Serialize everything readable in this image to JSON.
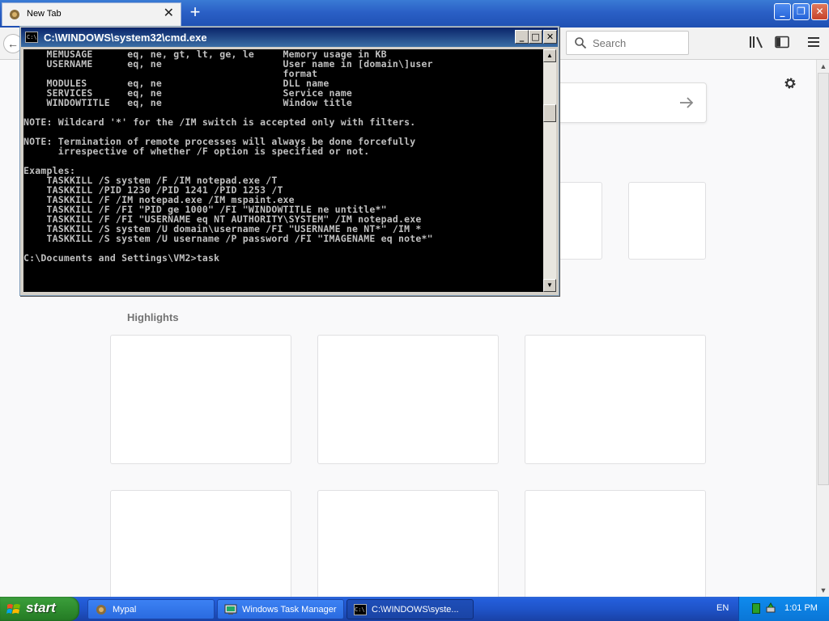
{
  "browser": {
    "tab_label": "New Tab",
    "tab_close": "✕",
    "new_tab": "+",
    "window_controls": {
      "minimize": "_",
      "maximize": "❐",
      "close": "✕"
    },
    "search_placeholder": "Search",
    "back_arrow": "←",
    "highlights_title": "Highlights"
  },
  "cmd": {
    "title": "C:\\WINDOWS\\system32\\cmd.exe",
    "controls": {
      "minimize": "_",
      "maximize": "□",
      "close": "✕"
    },
    "console_text": "    MEMUSAGE      eq, ne, gt, lt, ge, le     Memory usage in KB\n    USERNAME      eq, ne                     User name in [domain\\]user\n                                             format\n    MODULES       eq, ne                     DLL name\n    SERVICES      eq, ne                     Service name\n    WINDOWTITLE   eq, ne                     Window title\n\nNOTE: Wildcard '*' for the /IM switch is accepted only with filters.\n\nNOTE: Termination of remote processes will always be done forcefully\n      irrespective of whether /F option is specified or not.\n\nExamples:\n    TASKKILL /S system /F /IM notepad.exe /T\n    TASKKILL /PID 1230 /PID 1241 /PID 1253 /T\n    TASKKILL /F /IM notepad.exe /IM mspaint.exe\n    TASKKILL /F /FI \"PID ge 1000\" /FI \"WINDOWTITLE ne untitle*\"\n    TASKKILL /F /FI \"USERNAME eq NT AUTHORITY\\SYSTEM\" /IM notepad.exe\n    TASKKILL /S system /U domain\\username /FI \"USERNAME ne NT*\" /IM *\n    TASKKILL /S system /U username /P password /FI \"IMAGENAME eq note*\"\n\nC:\\Documents and Settings\\VM2>task"
  },
  "taskbar": {
    "start_label": "start",
    "items": [
      {
        "label": "Mypal"
      },
      {
        "label": "Windows Task Manager"
      },
      {
        "label": "C:\\WINDOWS\\syste..."
      }
    ],
    "language": "EN",
    "clock": "1:01 PM"
  }
}
